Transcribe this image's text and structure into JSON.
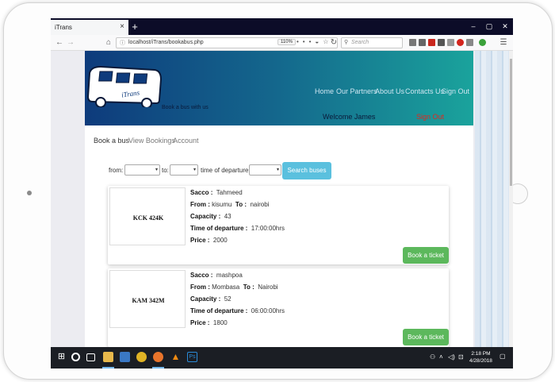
{
  "browser": {
    "tab_title": "iTrans",
    "tab_close": "×",
    "new_tab": "+",
    "url": "localhost/iTrans/bookabus.php",
    "zoom": "110%",
    "search_placeholder": "Search",
    "window_controls": [
      "–",
      "▢",
      "✕"
    ]
  },
  "site": {
    "logo_text": "iTrans",
    "tagline": "Book a bus with us",
    "nav": [
      "Home",
      "Our Partners",
      "About Us",
      "Contacts Us",
      "Sign Out"
    ],
    "welcome": "Welcome James",
    "signout": "Sign Out"
  },
  "subnav": [
    "Book a bus",
    "View Bookings",
    "Account"
  ],
  "search": {
    "from_label": "from:",
    "to_label": "to:",
    "time_label": "time of departure:",
    "button": "Search buses"
  },
  "labels": {
    "sacco": "Sacco :",
    "from": "From :",
    "to": "To :",
    "capacity": "Capacity :",
    "time": "Time of departure :",
    "price": "Price :",
    "book": "Book a ticket"
  },
  "buses": [
    {
      "plate": "KCK 424K",
      "sacco": "Tahmeed",
      "from": "kisumu",
      "to": "nairobi",
      "capacity": "43",
      "time": "17:00:00hrs",
      "price": "2000"
    },
    {
      "plate": "KAM 342M",
      "sacco": "mashpoa",
      "from": "Mombasa",
      "to": "Nairobi",
      "capacity": "52",
      "time": "06:00:00hrs",
      "price": "1800"
    }
  ],
  "taskbar": {
    "time": "2:18 PM",
    "date": "4/28/2018"
  },
  "colors": {
    "header_start": "#0e3b7c",
    "header_end": "#1aa39c",
    "search_button": "#5bc0de",
    "book_button": "#5cb85c",
    "signout_red": "#e0281f"
  }
}
